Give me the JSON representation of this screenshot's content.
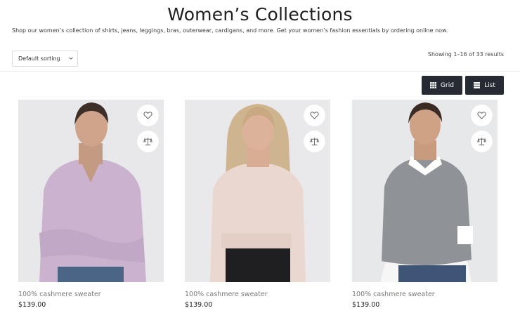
{
  "page": {
    "title": "Women’s Collections",
    "description": "Shop our women’s collection of shirts, jeans, leggings, bras, outerwear, cardigans, and more. Get your women’s fashion essentials by ordering online now."
  },
  "toolbar": {
    "sort_value": "Default sorting",
    "result_count": "Showing 1–16 of 33 results",
    "grid_label": "Grid",
    "list_label": "List"
  },
  "products": [
    {
      "name": "100% cashmere sweater",
      "price": "$139.00",
      "sweater_color": "#cbb3cf"
    },
    {
      "name": "100% cashmere sweater",
      "price": "$139.00",
      "sweater_color": "#ead7cf"
    },
    {
      "name": "100% cashmere sweater",
      "price": "$139.00",
      "sweater_color": "#8f9296"
    }
  ],
  "colors": {
    "button_dark": "#262a33",
    "photo_background": "#e7e7e9"
  },
  "icons": {
    "wishlist": "heart-icon",
    "compare": "scale-icon",
    "grid": "grid-icon",
    "list": "list-icon",
    "sort": "chevron-down-icon"
  }
}
